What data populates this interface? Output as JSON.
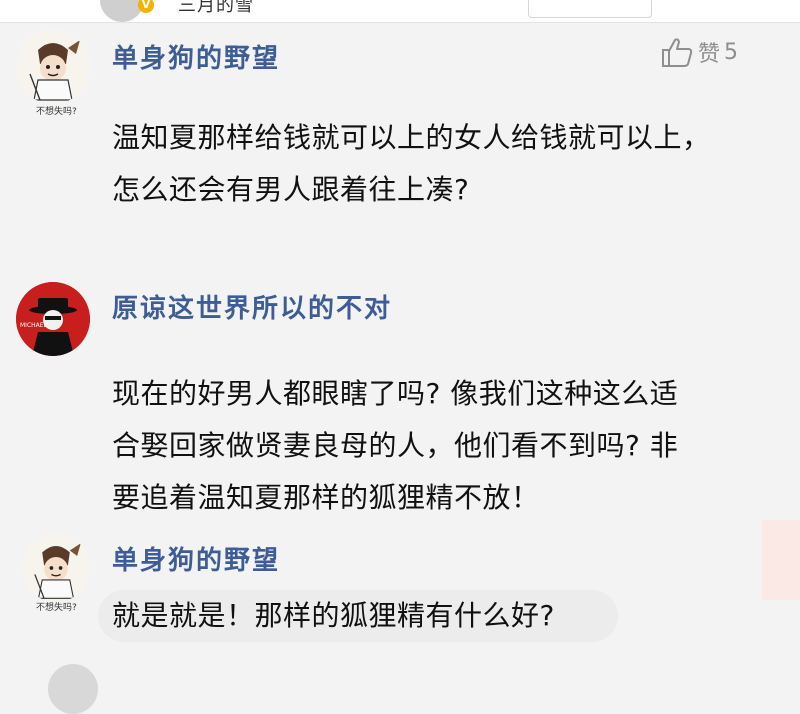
{
  "header": {
    "partial_username": "三月的雪",
    "badge_icon": "v-badge-icon"
  },
  "comments": [
    {
      "username": "单身狗的野望",
      "avatar_caption": "不想失吗?",
      "like_label": "赞",
      "like_count": "5",
      "lines": [
        "温知夏那样给钱就可以上的女人给钱就可以上，",
        "怎么还会有男人跟着往上凑?"
      ]
    },
    {
      "username": "原谅这世界所以的不对",
      "avatar_text": "MICHAEL",
      "lines": [
        "现在的好男人都眼瞎了吗? 像我们这种这么适",
        "合娶回家做贤妻良母的人，他们看不到吗? 非",
        "要追着温知夏那样的狐狸精不放！"
      ]
    },
    {
      "username": "单身狗的野望",
      "avatar_caption": "不想失吗?",
      "lines": [
        "就是就是！那样的狐狸精有什么好?"
      ]
    }
  ],
  "colors": {
    "username": "#3e5d96",
    "text": "#111111",
    "background": "#f3f3f3",
    "like": "#8e8e8e"
  }
}
